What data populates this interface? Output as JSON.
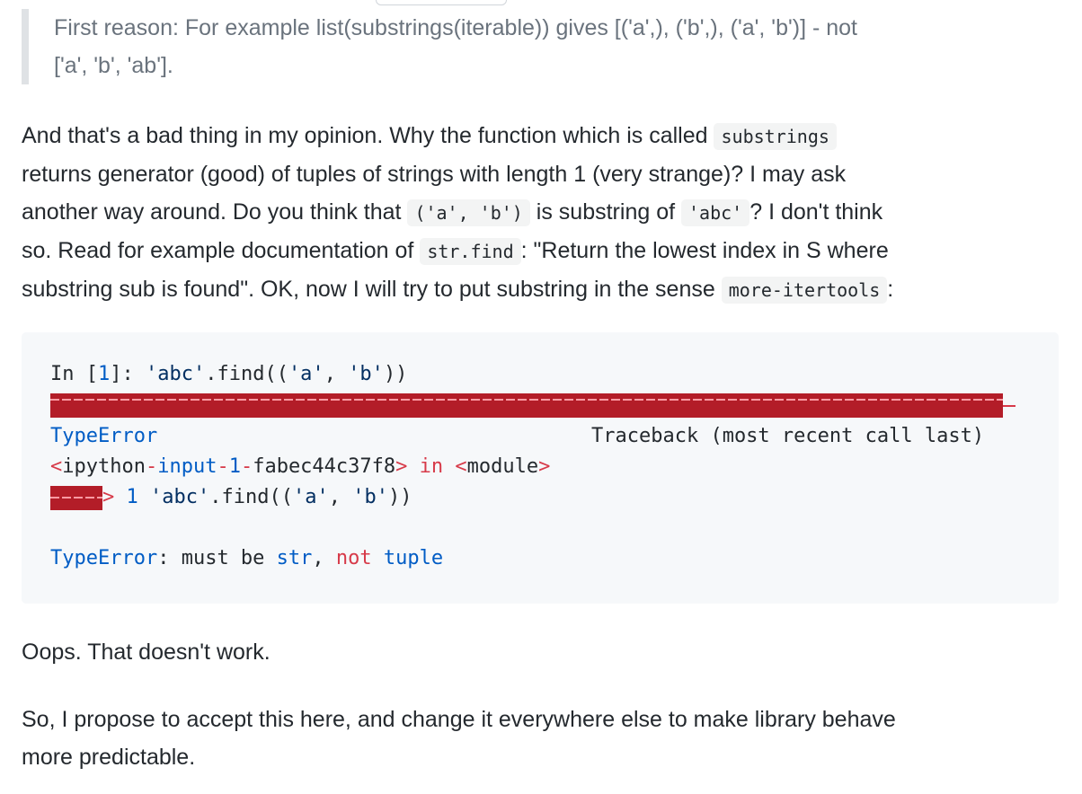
{
  "quote": {
    "line1": "First reason: For example list(substrings(iterable)) gives [('a',), ('b',), ('a', 'b')] - not",
    "line2": "['a', 'b', 'ab']."
  },
  "para1": {
    "t1": "And that's a bad thing in my opinion. Why the function which is called ",
    "c1": "substrings",
    "t2": "returns generator (good) of tuples of strings with length 1 (very strange)? I may ask",
    "t3": "another way around. Do you think that ",
    "c2": "('a', 'b')",
    "t4": " is substring of ",
    "c3": "'abc'",
    "t5": "? I don't think",
    "t6": "so. Read for example documentation of ",
    "c4": "str.find",
    "t7": ": \"Return the lowest index in S where",
    "t8": "substring sub is found\". OK, now I will try to put substring in the sense ",
    "c5": "more-itertools",
    "t9": ":"
  },
  "code": {
    "in_prefix": "In [",
    "in_num": "1",
    "in_suffix": "]: ",
    "call_a": "'abc'",
    "call_b": ".find((",
    "call_c": "'a'",
    "call_d": ", ",
    "call_e": "'b'",
    "call_f": "))",
    "err_name": "TypeError",
    "traceback": "Traceback (most recent call last)",
    "mod_lt": "<",
    "mod_a": "ipython",
    "mod_dash1": "-",
    "mod_b": "input",
    "mod_dash2": "-",
    "mod_c": "1",
    "mod_dash3": "-",
    "mod_d": "fabec44c37f8",
    "mod_gt": ">",
    "mod_in": " in ",
    "mod_lt2": "<",
    "mod_e": "module",
    "mod_gt2": ">",
    "arrow_gt": ">",
    "arrow_num": " 1 ",
    "err_final_name": "TypeError",
    "err_final_colon": ": must be ",
    "err_final_str": "str",
    "err_final_comma": ", ",
    "err_final_not": "not",
    "err_final_sp": " ",
    "err_final_tuple": "tuple"
  },
  "para2": "Oops. That doesn't work.",
  "para3": {
    "line1": "So, I propose to accept this here, and change it everywhere else to make library behave",
    "line2": "more predictable."
  },
  "colors": {
    "error_bar": "#b31d28",
    "keyword_red": "#d73a49",
    "builtin_blue": "#005cc5",
    "string_navy": "#032f62"
  }
}
